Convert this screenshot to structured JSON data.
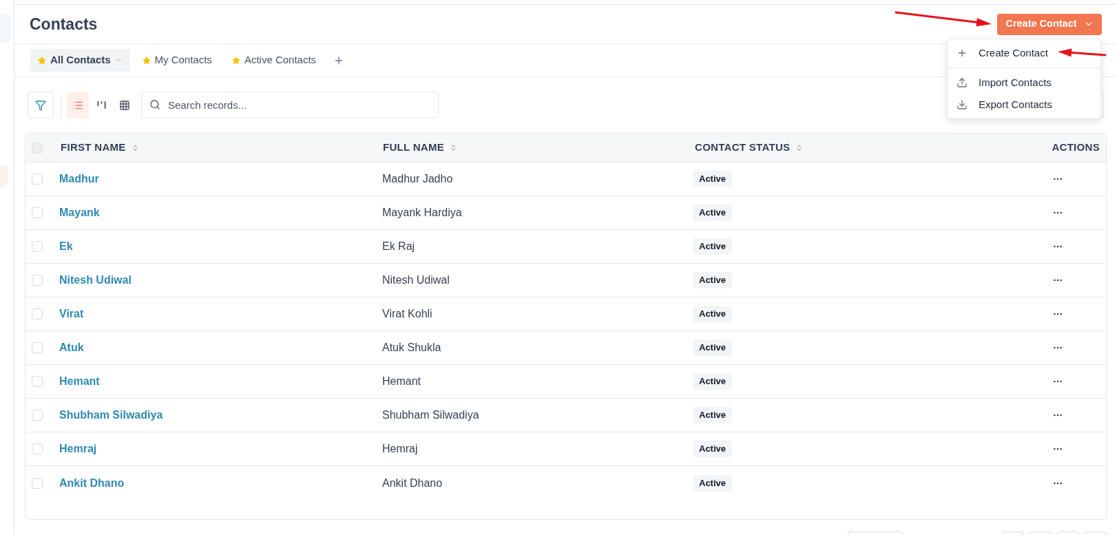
{
  "sidebar": {
    "items": [
      {
        "selected": false
      },
      {
        "selected": true
      }
    ]
  },
  "header": {
    "title": "Contacts",
    "create_button": {
      "label": "Create Contact",
      "expanded": true
    }
  },
  "views": [
    {
      "label": "All Contacts",
      "selected": true
    },
    {
      "label": "My Contacts",
      "selected": false
    },
    {
      "label": "Active Contacts",
      "selected": false
    }
  ],
  "toolbar": {
    "layouts": [
      {
        "kind": "list",
        "selected": true
      },
      {
        "kind": "kanban",
        "selected": false
      },
      {
        "kind": "grid",
        "selected": false
      }
    ],
    "search": {
      "placeholder": "Search records..."
    }
  },
  "create_menu": {
    "items": [
      {
        "kind": "create",
        "label": "Create Contact"
      },
      {
        "kind": "import",
        "label": "Import Contacts"
      },
      {
        "kind": "export",
        "label": "Export Contacts"
      }
    ]
  },
  "table": {
    "all_checked": false,
    "columns": [
      {
        "label": "FIRST NAME",
        "sortable": true
      },
      {
        "label": "FULL NAME",
        "sortable": true
      },
      {
        "label": "CONTACT STATUS",
        "sortable": true
      },
      {
        "label": "ACTIONS",
        "sortable": false
      }
    ],
    "rows": [
      {
        "checked": false,
        "first_name": "Madhur",
        "full_name": "Madhur Jadho",
        "status": "Active"
      },
      {
        "checked": false,
        "first_name": "Mayank",
        "full_name": "Mayank Hardiya",
        "status": "Active"
      },
      {
        "checked": false,
        "first_name": "Ek",
        "full_name": "Ek Raj",
        "status": "Active"
      },
      {
        "checked": false,
        "first_name": "Nitesh Udiwal",
        "full_name": "Nitesh Udiwal",
        "status": "Active"
      },
      {
        "checked": false,
        "first_name": "Virat",
        "full_name": "Virat Kohli",
        "status": "Active"
      },
      {
        "checked": false,
        "first_name": "Atuk",
        "full_name": "Atuk Shukla",
        "status": "Active"
      },
      {
        "checked": false,
        "first_name": "Hemant",
        "full_name": "Hemant",
        "status": "Active"
      },
      {
        "checked": false,
        "first_name": "Shubham Silwadiya",
        "full_name": "Shubham Silwadiya",
        "status": "Active"
      },
      {
        "checked": false,
        "first_name": "Hemraj",
        "full_name": "Hemraj",
        "status": "Active"
      },
      {
        "checked": false,
        "first_name": "Ankit Dhano",
        "full_name": "Ankit Dhano",
        "status": "Active"
      }
    ]
  }
}
